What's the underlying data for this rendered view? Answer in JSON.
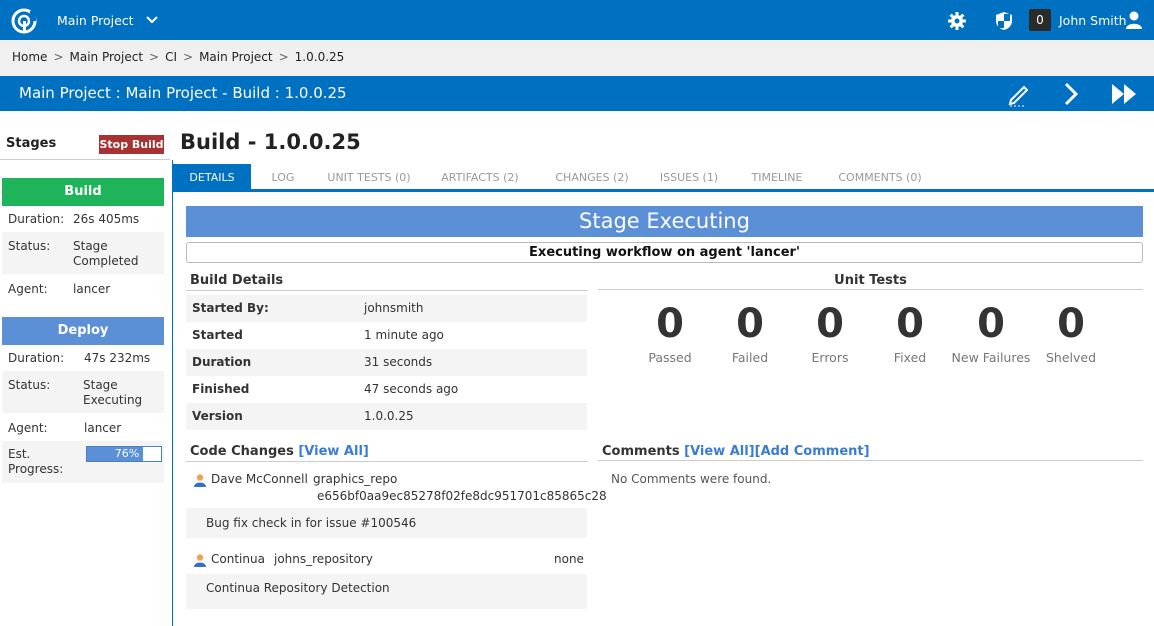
{
  "header": {
    "project": "Main Project",
    "notification_count": "0",
    "user": "John Smith"
  },
  "breadcrumb": [
    "Home",
    "Main Project",
    "CI",
    "Main Project",
    "1.0.0.25"
  ],
  "titlebar": {
    "title": "Main Project : Main Project - Build : 1.0.0.25"
  },
  "stages": {
    "heading": "Stages",
    "stop_label": "Stop Build",
    "build": {
      "name": "Build",
      "color": "#1fb35a",
      "duration_label": "Duration:",
      "duration": "26s 405ms",
      "status_label": "Status:",
      "status": "Stage Completed",
      "agent_label": "Agent:",
      "agent": "lancer"
    },
    "deploy": {
      "name": "Deploy",
      "color": "#5b8fd6",
      "duration_label": "Duration:",
      "duration": "47s 232ms",
      "status_label": "Status:",
      "status": "Stage Executing",
      "agent_label": "Agent:",
      "agent": "lancer",
      "progress_label": "Est. Progress:",
      "progress": "76%",
      "progress_value": 0.76
    }
  },
  "main": {
    "title": "Build - 1.0.0.25",
    "tabs": [
      "DETAILS",
      "LOG",
      "UNIT TESTS (0)",
      "ARTIFACTS (2)",
      "CHANGES (2)",
      "ISSUES (1)",
      "TIMELINE",
      "COMMENTS (0)"
    ],
    "banner": "Stage Executing",
    "workflow": "Executing workflow on agent 'lancer'",
    "build_details": {
      "title": "Build Details",
      "rows": [
        {
          "k": "Started By:",
          "v": "johnsmith"
        },
        {
          "k": "Started",
          "v": "1 minute ago"
        },
        {
          "k": "Duration",
          "v": "31 seconds"
        },
        {
          "k": "Finished",
          "v": "47 seconds ago"
        },
        {
          "k": "Version",
          "v": "1.0.0.25"
        }
      ]
    },
    "unit_tests": {
      "title": "Unit Tests",
      "items": [
        {
          "num": "0",
          "label": "Passed"
        },
        {
          "num": "0",
          "label": "Failed"
        },
        {
          "num": "0",
          "label": "Errors"
        },
        {
          "num": "0",
          "label": "Fixed"
        },
        {
          "num": "0",
          "label": "New Failures"
        },
        {
          "num": "0",
          "label": "Shelved"
        }
      ]
    },
    "code_changes": {
      "title": "Code Changes",
      "view_all": "[View All]",
      "changes": [
        {
          "author": "Dave McConnell",
          "repo": "graphics_repo",
          "revision": "e656bf0aa9ec85278f02fe8dc951701c85865c28",
          "message": "Bug fix check in for issue ",
          "issue": "#100546"
        },
        {
          "author": "Continua",
          "repo": "johns_repository",
          "revision": "none",
          "message": "Continua Repository Detection"
        }
      ]
    },
    "comments": {
      "title": "Comments",
      "view_all": "[View All]",
      "add": "[Add Comment]",
      "empty": "No Comments were found."
    }
  }
}
